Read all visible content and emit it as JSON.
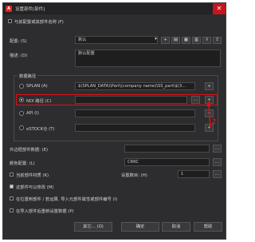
{
  "window": {
    "title": "设置部件[部件]",
    "app_icon_label": "A"
  },
  "top_checkbox": "与其配置或其部件名称 (F)",
  "config": {
    "label": "配置: (S)",
    "value": "默认",
    "tools": [
      "▾",
      "+",
      "▤",
      "▦",
      "▥",
      "⇩",
      "⇪"
    ]
  },
  "description": {
    "label": "描述: (D)",
    "value": "默认配置"
  },
  "group": {
    "title": "数据路径",
    "rows": [
      {
        "label": "SPLAN (A)",
        "value": "$(SPLAN_DATA)\\Part\\(company name)\\SS_part\\$(3...",
        "selected": false
      },
      {
        "label": "NDI 路径 (C)",
        "value": "",
        "selected": true
      },
      {
        "label": "API (I)",
        "value": "",
        "selected": false
      },
      {
        "label": "eSTOCK仓 (T)",
        "value": "",
        "selected": false
      }
    ],
    "dots_label": "...",
    "plus_label": "+"
  },
  "annotation": {
    "number": "2",
    "color": "#e01010"
  },
  "fields": {
    "part_number_label": "外边框部件数据: (E)",
    "part_number_value": "",
    "color_label": "颜色配置: (L)",
    "color_value": "CRKC"
  },
  "options": {
    "opt1": "当前部件材质 (K)",
    "opt2": "这部件可以修改 (M)",
    "opt3": "在位置到部件 / 若运算, 导入元部件属性或部件编号 (I)",
    "opt4": "在导入部件后重新设置数据 (P)",
    "count_label": "设置数目: (H)",
    "count_value": "1",
    "opt2_checked": true
  },
  "buttons": {
    "other": "其它... (O)",
    "ok": "确定",
    "cancel": "取消",
    "help": "帮助"
  }
}
